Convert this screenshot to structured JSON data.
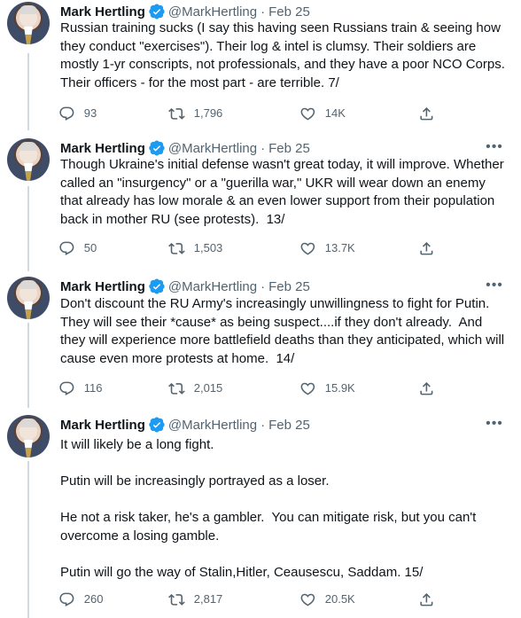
{
  "author": {
    "name": "Mark Hertling",
    "handle": "@MarkHertling",
    "separator": "·",
    "verified": true
  },
  "icons": {
    "verified": "verified-badge-icon",
    "more": "more-options-icon",
    "reply": "reply-icon",
    "retweet": "retweet-icon",
    "like": "like-icon",
    "share": "share-icon"
  },
  "colors": {
    "verified": "#1d9bf0",
    "text": "#0f1419",
    "secondary": "#536471",
    "thread_line": "#cfd9de"
  },
  "tweets": [
    {
      "date": "Feb 25",
      "text": "Russian training sucks (I say this having seen Russians train & seeing how they conduct \"exercises\"). Their log & intel is clumsy. Their soldiers are mostly 1-yr conscripts, not professionals, and they have a poor NCO Corps. Their officers - for the most part - are terrible. 7/",
      "replies": "93",
      "retweets": "1,796",
      "likes": "14K"
    },
    {
      "date": "Feb 25",
      "text": "Though Ukraine's initial defense wasn't great today, it will improve. Whether called an \"insurgency\" or a \"guerilla war,\" UKR will wear down an enemy that already has low morale & an even lower support from their population back in mother RU (see protests).  13/",
      "replies": "50",
      "retweets": "1,503",
      "likes": "13.7K"
    },
    {
      "date": "Feb 25",
      "text": "Don't discount the RU Army's increasingly unwillingness to fight for Putin. They will see their *cause* as being suspect....if they don't already.  And they will experience more battlefield deaths than they anticipated, which will cause even more protests at home.  14/",
      "replies": "116",
      "retweets": "2,015",
      "likes": "15.9K"
    },
    {
      "date": "Feb 25",
      "text": "It will likely be a long fight.\n\nPutin will be increasingly portrayed as a loser.\n\nHe not a risk taker, he's a gambler.  You can mitigate risk, but you can't overcome a losing gamble.\n\nPutin will go the way of Stalin,Hitler, Ceausescu, Saddam. 15/",
      "replies": "260",
      "retweets": "2,817",
      "likes": "20.5K"
    }
  ]
}
